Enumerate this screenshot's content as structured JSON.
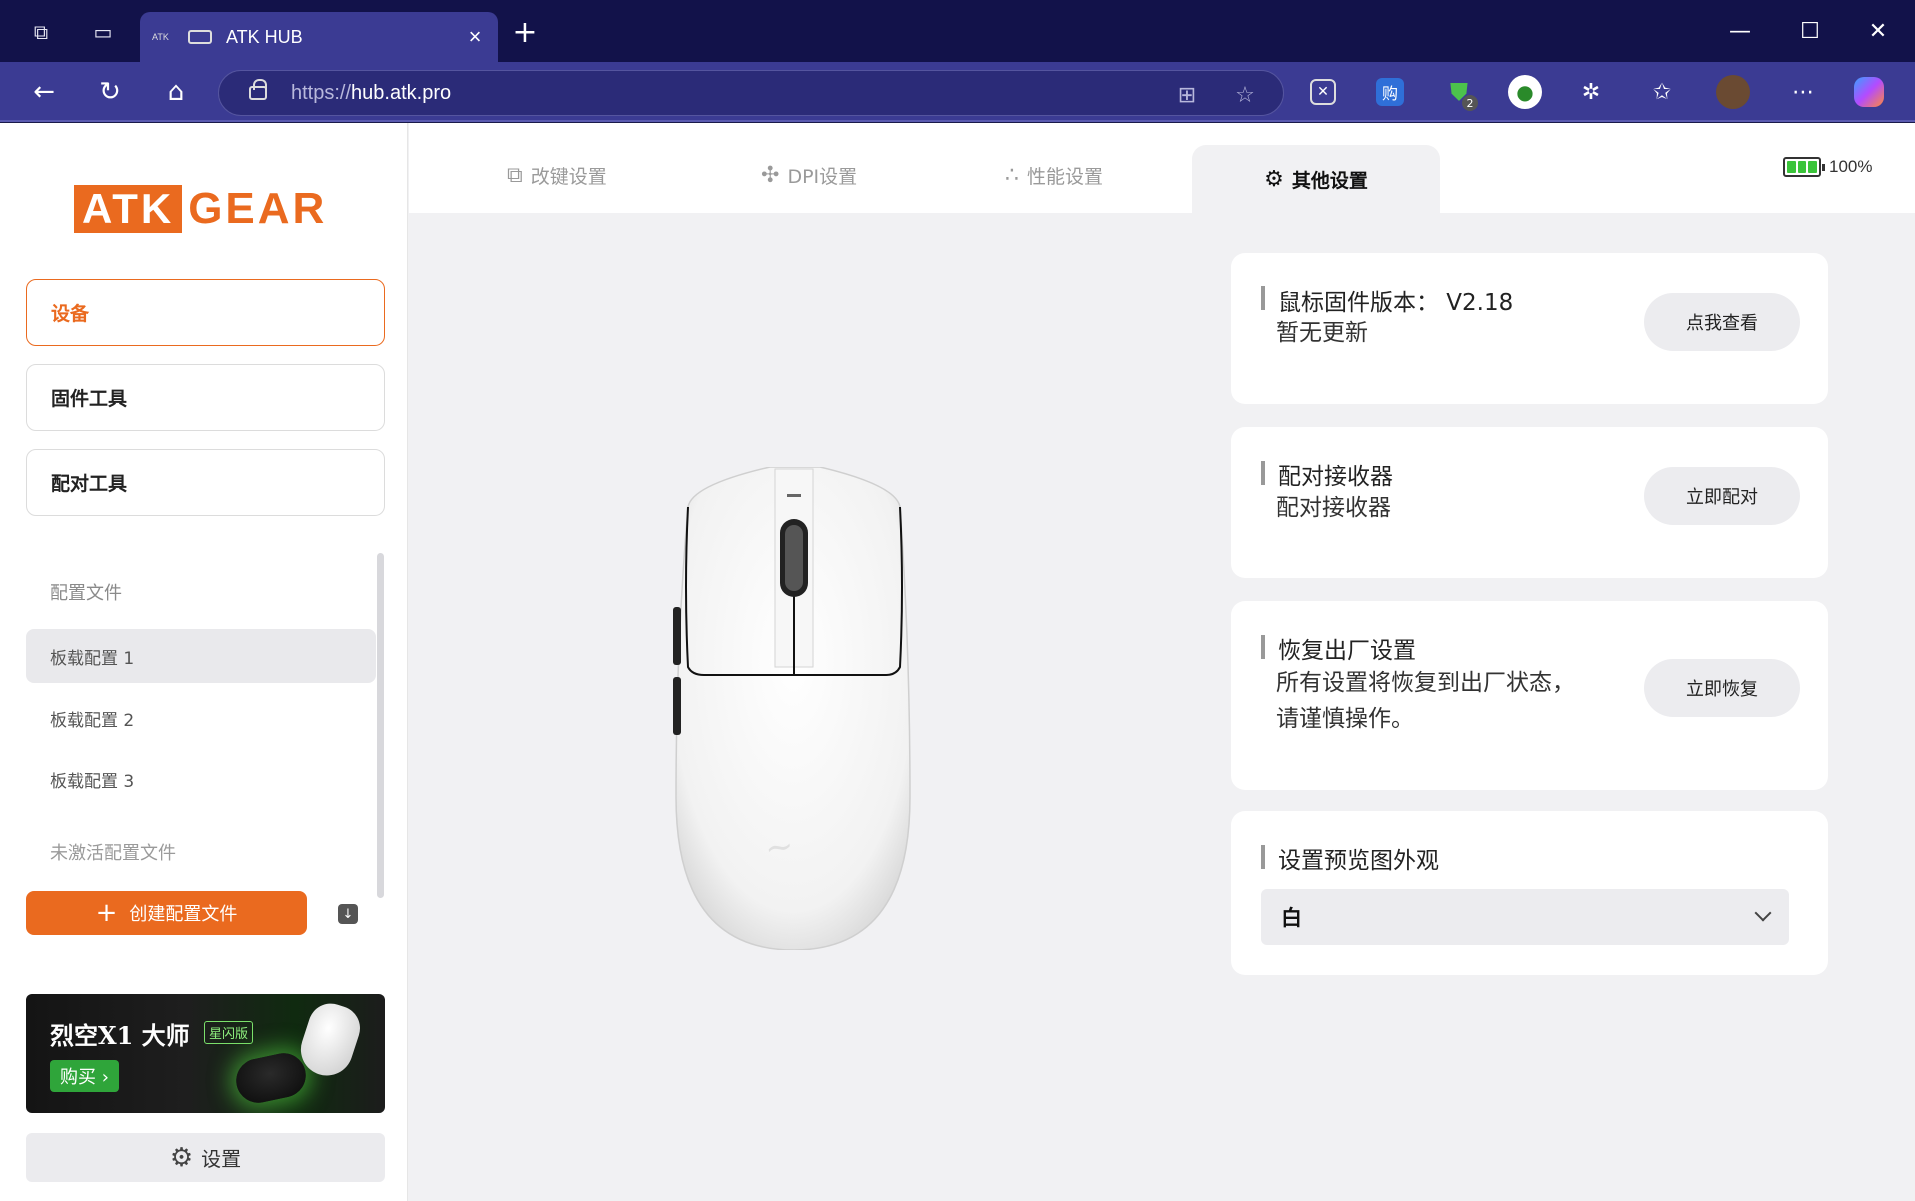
{
  "browser": {
    "tab_favicon": "ATK",
    "tab_title": "ATK HUB",
    "url_scheme": "https://",
    "url_host": "hub.atk.pro",
    "extension_badge": "2"
  },
  "sidebar": {
    "logo_left": "ATK",
    "logo_right": "GEAR",
    "nav": [
      {
        "label": "设备",
        "active": true
      },
      {
        "label": "固件工具",
        "active": false
      },
      {
        "label": "配对工具",
        "active": false
      }
    ],
    "profiles_label": "配置文件",
    "profiles": [
      {
        "label": "板载配置 1",
        "active": true
      },
      {
        "label": "板载配置 2",
        "active": false
      },
      {
        "label": "板载配置 3",
        "active": false
      }
    ],
    "inactive_label": "未激活配置文件",
    "create_button": "创建配置文件",
    "banner": {
      "title": "烈空X1 大师",
      "badge": "星闪版",
      "buy": "购买 ›"
    },
    "settings_label": "设置"
  },
  "tabs": [
    {
      "label": "改键设置",
      "icon": "keymap-icon",
      "active": false
    },
    {
      "label": "DPI设置",
      "icon": "dpi-icon",
      "active": false
    },
    {
      "label": "性能设置",
      "icon": "performance-icon",
      "active": false
    },
    {
      "label": "其他设置",
      "icon": "gear-icon",
      "active": true
    }
  ],
  "battery": {
    "percent_text": "100%",
    "level": 1.0
  },
  "cards": {
    "firmware": {
      "title": "鼠标固件版本：  V2.18",
      "desc": "暂无更新",
      "action": "点我查看"
    },
    "pair": {
      "title": "配对接收器",
      "desc": "配对接收器",
      "action": "立即配对"
    },
    "reset": {
      "title": "恢复出厂设置",
      "desc_line1": "所有设置将恢复到出厂状态，",
      "desc_line2": "请谨慎操作。",
      "action": "立即恢复"
    },
    "appearance": {
      "title": "设置预览图外观",
      "selected": "白"
    }
  },
  "colors": {
    "accent": "#ea6a1f",
    "chrome": "#3b3b93",
    "titlebar": "#12124a",
    "battery": "#3ac43a"
  }
}
